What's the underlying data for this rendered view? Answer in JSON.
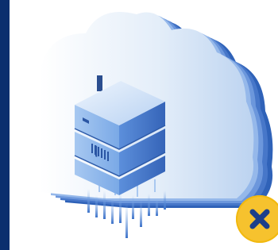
{
  "scene": {
    "subject_icon": "cloud-server-icon",
    "status_icon": "close-icon",
    "colors": {
      "background": "#0b2f6e",
      "panel": "#ffffff",
      "cloud_light": "#dbe8f6",
      "cloud_mid": "#8fb4e4",
      "cloud_dark": "#3d6fc6",
      "server_light": "#d6e6f8",
      "server_mid": "#8fb8ec",
      "server_dark": "#3c72c9",
      "badge": "#f6c22e",
      "badge_icon": "#1c3f8a"
    }
  }
}
